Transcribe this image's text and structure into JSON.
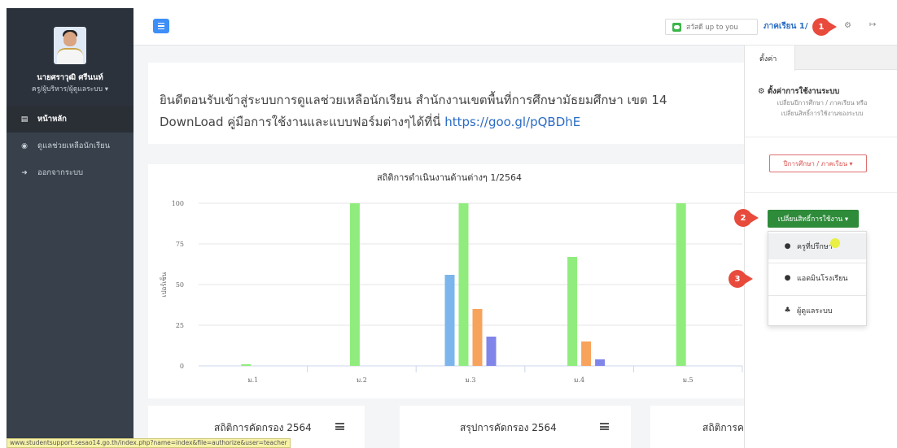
{
  "sidebar": {
    "user_name": "นายศราวุฒิ ศรีนนท์",
    "user_role": "ครู/ผู้บริหาร/ผู้ดูแลระบบ ▾",
    "items": [
      {
        "label": "หน้าหลัก",
        "icon": "dashboard-icon",
        "active": true
      },
      {
        "label": "ดูแลช่วยเหลือนักเรียน",
        "icon": "globe-icon",
        "active": false
      },
      {
        "label": "ออกจากระบบ",
        "icon": "logout-icon",
        "active": false
      }
    ]
  },
  "topbar": {
    "line_text": "สวัสดี up to you",
    "term_text": "ภาคเรียน 1/",
    "menu_icon": "hamburger-icon",
    "gear_icon": "gear-icon",
    "signout_icon": "signout-icon"
  },
  "welcome": {
    "line1": "ยินดีตอนรับเข้าสู่ระบบการดูแลช่วยเหลือนักเรียน สำนักงานเขตพื้นที่การศึกษามัธยมศึกษา เขต 14",
    "line2_prefix": "DownLoad คู่มือการใช้งานและแบบฟอร์มต่างๆได้ที่นี่ ",
    "line2_link": "https://goo.gl/pQBDhE"
  },
  "chart_data": {
    "type": "bar",
    "title": "สถิติการดำเนินงานด้านต่างๆ 1/2564",
    "ylabel": "เปอร์เซ็น",
    "xlabel": "",
    "ylim": [
      0,
      100
    ],
    "yticks": [
      0,
      25,
      50,
      75,
      100
    ],
    "categories": [
      "ม.1",
      "ม.2",
      "ม.3",
      "ม.4",
      "ม.5"
    ],
    "series": [
      {
        "color": "#7cb5ec",
        "values": [
          0,
          0,
          56,
          0,
          0
        ]
      },
      {
        "color": "#90ed7d",
        "values": [
          1,
          100,
          100,
          67,
          100
        ]
      },
      {
        "color": "#f7a35c",
        "values": [
          0,
          0,
          35,
          15,
          0
        ]
      },
      {
        "color": "#8085e9",
        "values": [
          0,
          0,
          18,
          4,
          0
        ]
      }
    ]
  },
  "bottom_cards": [
    {
      "title": "สถิติการคัดกรอง 2564"
    },
    {
      "title": "สรุปการคัดกรอง 2564"
    },
    {
      "title": "สถิติการค"
    }
  ],
  "panel": {
    "tab": "ตั้งค่า",
    "heading": "ตั้งค่าการใช้งานระบบ",
    "sub1": "เปลี่ยนปีการศึกษา / ภาคเรียน หรือ",
    "sub2": "เปลี่ยนสิทธิ์การใช้งานของระบบ",
    "year_button": "ปีการศึกษา / ภาคเรียน ▾",
    "role_button": "เปลี่ยนสิทธิ์การใช้งาน ▾",
    "role_options": [
      {
        "label": "ครูที่ปรึกษา",
        "icon": "user-icon"
      },
      {
        "label": "แอดมินโรงเรียน",
        "icon": "users-icon"
      },
      {
        "label": "ผู้ดูแลระบบ",
        "icon": "sitemap-icon"
      }
    ]
  },
  "callouts": [
    "1",
    "2",
    "3"
  ],
  "status_url": "www.studentsupport.sesao14.go.th/index.php?name=index&file=authorize&user=teacher"
}
